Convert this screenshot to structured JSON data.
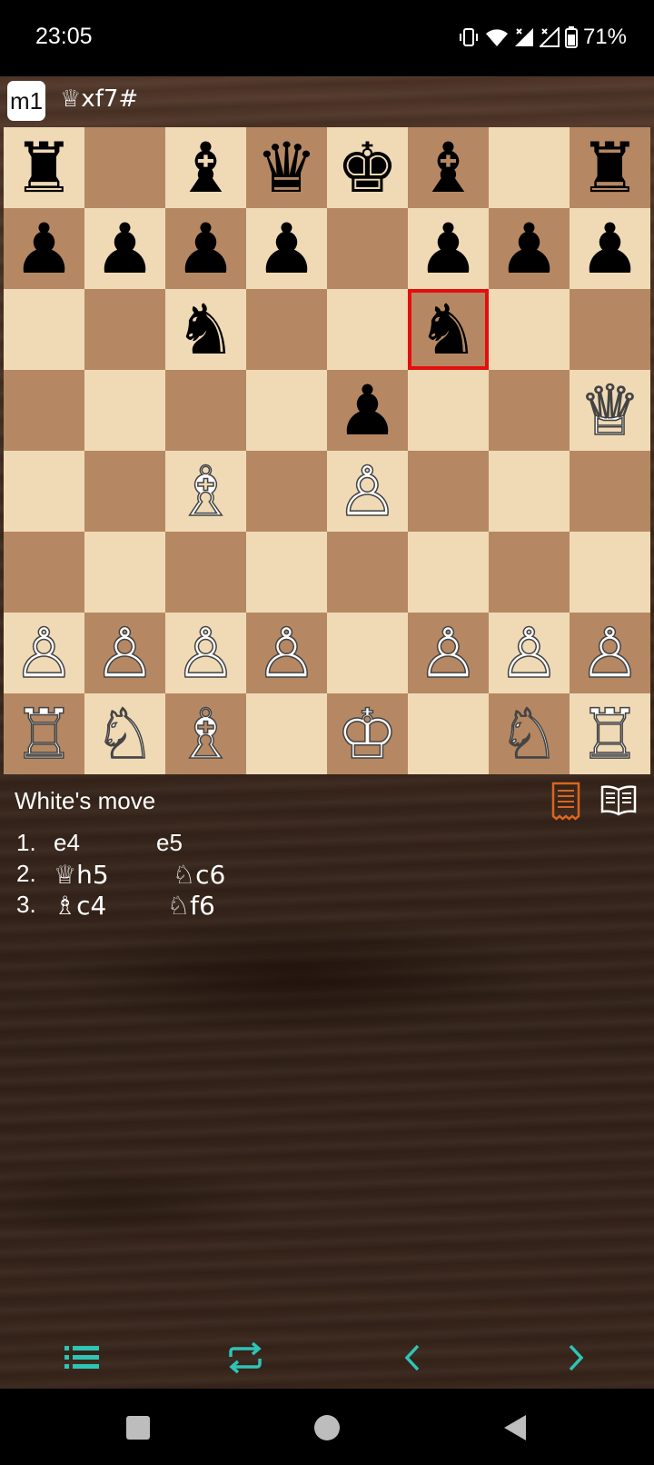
{
  "status_bar": {
    "time": "23:05",
    "battery": "71%",
    "icons": [
      "vibrate-icon",
      "wifi-icon",
      "signal-icon",
      "signal-icon",
      "battery-icon"
    ]
  },
  "header": {
    "logo_text": "m1",
    "last_move": "♕xf7#"
  },
  "board": {
    "highlight_square": "f6",
    "rows": [
      [
        "♜",
        "",
        "♝",
        "♛",
        "♚",
        "♝",
        "",
        "♜"
      ],
      [
        "♟",
        "♟",
        "♟",
        "♟",
        "",
        "♟",
        "♟",
        "♟"
      ],
      [
        "",
        "",
        "♞",
        "",
        "",
        "♞",
        "",
        ""
      ],
      [
        "",
        "",
        "",
        "",
        "♟",
        "",
        "",
        "♕"
      ],
      [
        "",
        "",
        "♗",
        "",
        "♙",
        "",
        "",
        ""
      ],
      [
        "",
        "",
        "",
        "",
        "",
        "",
        "",
        ""
      ],
      [
        "♙",
        "♙",
        "♙",
        "♙",
        "",
        "♙",
        "♙",
        "♙"
      ],
      [
        "♖",
        "♘",
        "♗",
        "",
        "♔",
        "",
        "♘",
        "♖"
      ]
    ],
    "colors": [
      "b",
      "b",
      "b",
      "b",
      "b",
      "b",
      "b",
      "b",
      "b",
      "b",
      "b",
      "b",
      "b",
      "b",
      "b",
      "b",
      "b",
      "b",
      "b",
      "b",
      "b",
      "b",
      "b",
      "b",
      "b",
      "b",
      "b",
      "b",
      "b",
      "b",
      "b",
      "w",
      "b",
      "b",
      "w",
      "b",
      "w",
      "b",
      "b",
      "b",
      "b",
      "b",
      "b",
      "b",
      "b",
      "b",
      "b",
      "b",
      "w",
      "w",
      "w",
      "w",
      "w",
      "w",
      "w",
      "w",
      "w",
      "w",
      "w",
      "w",
      "w",
      "w",
      "w",
      "w"
    ]
  },
  "game": {
    "turn_text": "White's move",
    "moves": [
      {
        "num": "1.",
        "white": "e4",
        "black": "e5"
      },
      {
        "num": "2.",
        "white": "♕h5",
        "black": "♘c6"
      },
      {
        "num": "3.",
        "white": "♗c4",
        "black": "♘f6"
      }
    ]
  },
  "toolbar": {
    "icons": [
      "list-icon",
      "flip-board-icon",
      "previous-icon",
      "next-icon"
    ]
  },
  "colors": {
    "accent": "#2ec4b6",
    "highlight": "#e40e0e",
    "light_square": "#f0dab5",
    "dark_square": "#b58863",
    "notation_icon": "#d9661f"
  }
}
